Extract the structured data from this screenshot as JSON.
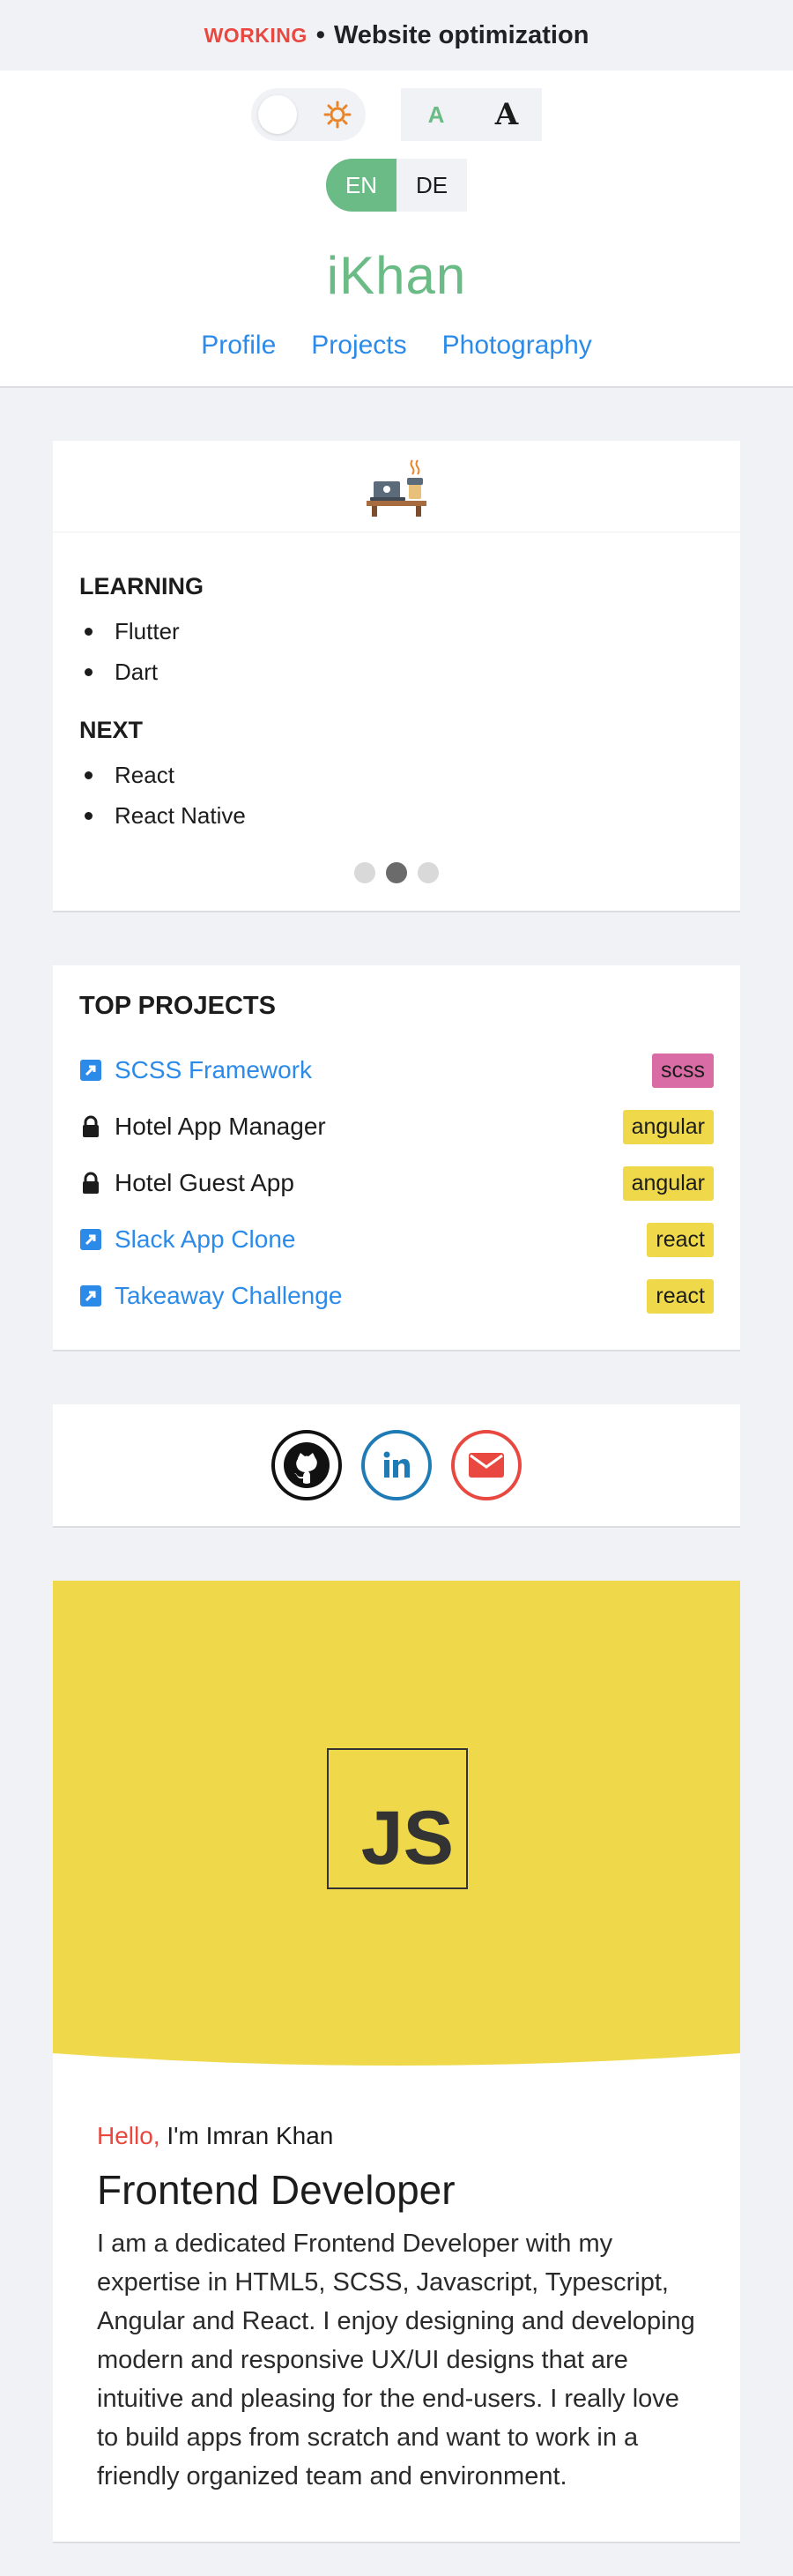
{
  "topbar": {
    "status": "WORKING",
    "separator": "•",
    "text": "Website optimization"
  },
  "controls": {
    "theme_icon": "sun-icon",
    "font_small": "A",
    "font_large": "A",
    "lang_active": "EN",
    "lang_inactive": "DE"
  },
  "brand": "iKhan",
  "nav": [
    "Profile",
    "Projects",
    "Photography"
  ],
  "status_card": {
    "illustration": "desk-laptop-coffee-icon",
    "sections": [
      {
        "title": "LEARNING",
        "items": [
          "Flutter",
          "Dart"
        ]
      },
      {
        "title": "NEXT",
        "items": [
          "React",
          "React Native"
        ]
      }
    ],
    "carousel_active_index": 1
  },
  "projects": {
    "title": "TOP PROJECTS",
    "items": [
      {
        "name": "SCSS Framework",
        "type": "link",
        "icon": "external-link-icon",
        "tag": "scss",
        "tag_color": "#d96ba5"
      },
      {
        "name": "Hotel App Manager",
        "type": "locked",
        "icon": "lock-icon",
        "tag": "angular",
        "tag_color": "#efd94b"
      },
      {
        "name": "Hotel Guest App",
        "type": "locked",
        "icon": "lock-icon",
        "tag": "angular",
        "tag_color": "#efd94b"
      },
      {
        "name": "Slack App Clone",
        "type": "link",
        "icon": "external-link-icon",
        "tag": "react",
        "tag_color": "#efd94b"
      },
      {
        "name": "Takeaway Challenge",
        "type": "link",
        "icon": "external-link-icon",
        "tag": "react",
        "tag_color": "#efd94b"
      }
    ]
  },
  "social": [
    {
      "name": "github-icon",
      "color": "#111111"
    },
    {
      "name": "linkedin-icon",
      "color": "#1f7bb5"
    },
    {
      "name": "email-icon",
      "color": "#e8483f"
    }
  ],
  "intro": {
    "logo_text": "JS",
    "hello": "Hello,",
    "name": "I'm Imran Khan",
    "role": "Frontend Developer",
    "about": "I am a dedicated Frontend Developer with my expertise in HTML5, SCSS, Javascript, Typescript, Angular and React. I enjoy designing and developing modern and responsive UX/UI designs that are intuitive and pleasing for the end-users. I really love to build apps from scratch and want to work in a friendly organized team and environment."
  },
  "colors": {
    "accent": "#6bbb86",
    "link": "#2c8be8",
    "warning": "#e8483f",
    "js_yellow": "#efd94b"
  }
}
